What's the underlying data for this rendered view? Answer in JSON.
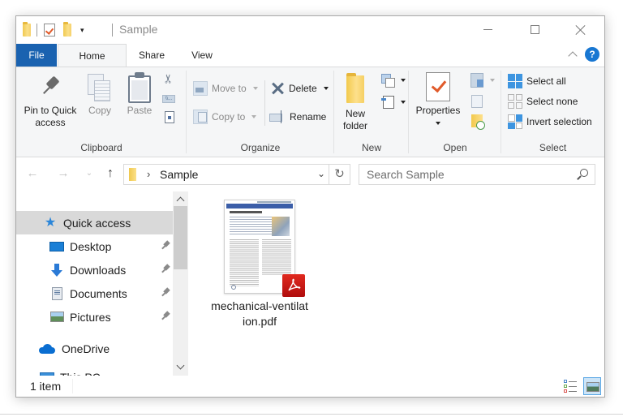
{
  "window": {
    "title": "Sample",
    "controls": {
      "minimize": "Minimize",
      "maximize": "Maximize",
      "close": "Close"
    }
  },
  "quick_access_toolbar": {
    "items": [
      "folder-icon",
      "properties-icon",
      "new-folder-icon"
    ],
    "customize": "▾"
  },
  "ribbon_tabs": [
    {
      "label": "File",
      "active": false
    },
    {
      "label": "Home",
      "active": true
    },
    {
      "label": "Share",
      "active": false
    },
    {
      "label": "View",
      "active": false
    }
  ],
  "help": {
    "label": "?"
  },
  "ribbon": {
    "clipboard": {
      "label": "Clipboard",
      "pin": {
        "line1": "Pin to Quick",
        "line2": "access"
      },
      "copy": "Copy",
      "paste": "Paste",
      "cut_icon": "scissors-icon",
      "copy_path_icon": "copy-path-icon",
      "paste_shortcut_icon": "paste-shortcut-icon"
    },
    "organize": {
      "label": "Organize",
      "move_to": "Move to",
      "copy_to": "Copy to",
      "delete": "Delete",
      "rename": "Rename"
    },
    "new": {
      "label": "New",
      "new_folder": {
        "line1": "New",
        "line2": "folder"
      }
    },
    "open": {
      "label": "Open",
      "properties": "Properties"
    },
    "select": {
      "label": "Select",
      "select_all": "Select all",
      "select_none": "Select none",
      "invert_selection": "Invert selection"
    }
  },
  "address": {
    "path": [
      "Sample"
    ],
    "separator": "›",
    "refresh_icon": "↻",
    "dropdown_icon": "⌄"
  },
  "navigation": {
    "back": "←",
    "forward": "→",
    "recent": "⌄",
    "up": "↑"
  },
  "search": {
    "placeholder": "Search Sample",
    "value": ""
  },
  "nav_pane": {
    "items": [
      {
        "label": "Quick access",
        "icon": "star-icon",
        "selected": true,
        "pinned": false
      },
      {
        "label": "Desktop",
        "icon": "desktop-icon",
        "selected": false,
        "pinned": true
      },
      {
        "label": "Downloads",
        "icon": "downloads-icon",
        "selected": false,
        "pinned": true
      },
      {
        "label": "Documents",
        "icon": "documents-icon",
        "selected": false,
        "pinned": true
      },
      {
        "label": "Pictures",
        "icon": "pictures-icon",
        "selected": false,
        "pinned": true
      },
      {
        "label": "OneDrive",
        "icon": "onedrive-icon",
        "selected": false,
        "pinned": false
      },
      {
        "label": "This PC",
        "icon": "this-pc-icon",
        "selected": false,
        "pinned": false
      }
    ]
  },
  "files": [
    {
      "name": "mechanical-ventilation.pdf",
      "type": "pdf"
    }
  ],
  "status": {
    "item_count": "1 item"
  },
  "colors": {
    "file_tab": "#1a62b0",
    "accent": "#1877d2",
    "pdf_badge": "#c8161d",
    "selected_nav": "#d9d9d9"
  }
}
